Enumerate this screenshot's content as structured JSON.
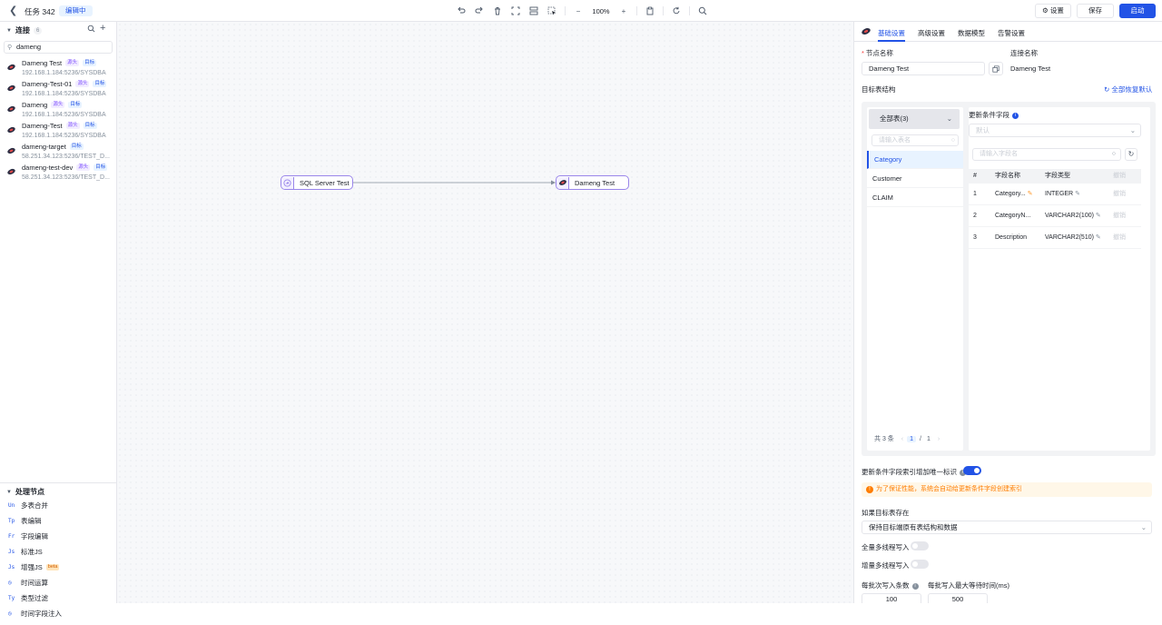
{
  "header": {
    "title": "任务 342",
    "status": "编辑中",
    "zoom": "100%",
    "settings_label": "设置",
    "save_label": "保存",
    "start_label": "启动"
  },
  "sidebar": {
    "connections_title": "连接",
    "connections_count": "6",
    "search_value": "dameng",
    "connections": [
      {
        "name": "Dameng Test",
        "tags": [
          "源头",
          "目标"
        ],
        "address": "192.168.1.184:5236/SYSDBA"
      },
      {
        "name": "Dameng-Test-01",
        "tags": [
          "源头",
          "目标"
        ],
        "address": "192.168.1.184:5236/SYSDBA"
      },
      {
        "name": "Dameng",
        "tags": [
          "源头",
          "目标"
        ],
        "address": "192.168.1.184:5236/SYSDBA"
      },
      {
        "name": "Dameng-Test",
        "tags": [
          "源头",
          "目标"
        ],
        "address": "192.168.1.184:5236/SYSDBA"
      },
      {
        "name": "dameng-target",
        "tags": [
          "目标"
        ],
        "address": "58.251.34.123:5236/TEST_D..."
      },
      {
        "name": "dameng-test-dev",
        "tags": [
          "源头",
          "目标"
        ],
        "address": "58.251.34.123:5236/TEST_D..."
      }
    ],
    "process_title": "处理节点",
    "process_nodes": [
      {
        "icon": "Un",
        "label": "多表合并"
      },
      {
        "icon": "Tp",
        "label": "表编辑"
      },
      {
        "icon": "Fr",
        "label": "字段编辑"
      },
      {
        "icon": "Js",
        "label": "标准JS"
      },
      {
        "icon": "Js",
        "label": "增强JS",
        "badge": "beta"
      },
      {
        "icon": "clock-icon",
        "label": "时间运算"
      },
      {
        "icon": "type-icon",
        "label": "类型过滤"
      },
      {
        "icon": "clock-icon",
        "label": "时间字段注入"
      }
    ]
  },
  "canvas": {
    "source_node": "SQL Server Test",
    "target_node": "Dameng Test"
  },
  "panel": {
    "tabs": [
      "基础设置",
      "高级设置",
      "数据模型",
      "告警设置"
    ],
    "node_name_label": "节点名称",
    "node_name_value": "Dameng Test",
    "connection_name_label": "连接名称",
    "connection_name_value": "Dameng Test",
    "target_structure_label": "目标表结构",
    "reset_all_label": "全部恢复默认",
    "all_tables_label": "全部表(3)",
    "table_search_placeholder": "请输入表名",
    "tables": [
      "Category",
      "Customer",
      "CLAIM"
    ],
    "total_label": "共 3 条",
    "page_current": "1",
    "page_sep": "/",
    "page_total": "1",
    "update_field_label": "更新条件字段",
    "update_field_value": "默认",
    "field_search_placeholder": "请输入字段名",
    "columns": [
      "#",
      "字段名称",
      "字段类型",
      "撤销"
    ],
    "fields": [
      {
        "idx": "1",
        "name": "Category...",
        "type": "INTEGER",
        "action": "撤销",
        "key": true
      },
      {
        "idx": "2",
        "name": "CategoryN...",
        "type": "VARCHAR2(100)",
        "action": "撤销",
        "key": false
      },
      {
        "idx": "3",
        "name": "Description",
        "type": "VARCHAR2(510)",
        "action": "撤销",
        "key": false
      }
    ],
    "unique_index_label": "更新条件字段索引增加唯一标识",
    "unique_index_on": true,
    "warning_text": "为了保证性能，系统会自动给更新条件字段创建索引",
    "if_exists_label": "如果目标表存在",
    "if_exists_value": "保持目标端原有表结构和数据",
    "full_multithread_label": "全量多线程写入",
    "incr_multithread_label": "增量多线程写入",
    "batch_size_label": "每批次写入条数",
    "batch_wait_label": "每批写入最大等待时间(ms)",
    "batch_size_value": "100",
    "batch_wait_value": "500"
  },
  "colors": {
    "primary": "#2253e6",
    "node_border": "#9a86ea",
    "warning": "#ff7d00"
  }
}
